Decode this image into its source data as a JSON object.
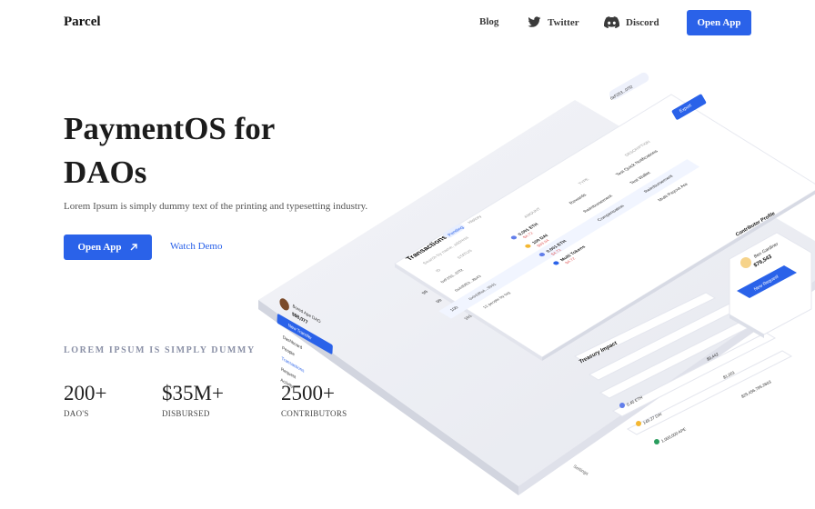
{
  "nav": {
    "logo": "Parcel",
    "blog": "Blog",
    "twitter": "Twitter",
    "discord": "Discord",
    "cta": "Open App"
  },
  "hero": {
    "title_line1": "PaymentOS for",
    "title_line2": "DAOs",
    "subtitle": "Lorem Ipsum is simply dummy text of the printing and typesetting industry.",
    "primary_button": "Open App",
    "secondary_link": "Watch Demo"
  },
  "stats": {
    "eyebrow": "LOREM IPSUM IS SIMPLY DUMMY",
    "items": [
      {
        "value": "200+",
        "label": "DAO'S"
      },
      {
        "value": "$35M+",
        "label": "DISBURSED"
      },
      {
        "value": "2500+",
        "label": "CONTRIBUTORS"
      }
    ]
  },
  "mockup": {
    "sidebar": {
      "dao_name": "Bored Ape DAO",
      "balance": "$98,077",
      "new_transfer": "New Transfer",
      "items": [
        "Dashboard",
        "People",
        "Transactions",
        "Request",
        "Activity"
      ],
      "settings": "Settings"
    },
    "header": {
      "address": "0xF253...07f2",
      "export": "Export",
      "title": "Transactions",
      "tab_pending": "Pending",
      "tab_history": "History",
      "search_placeholder": "Search by name, address"
    },
    "columns": [
      "ID",
      "STATUS",
      "AMOUNT",
      "TYPE",
      "DESCRIPTION"
    ],
    "rows": [
      {
        "id": "98",
        "date": "Dec 1, 2021",
        "who": "0xF253...07f2",
        "amount": "0.001 ETH",
        "fiat": "$4.72",
        "type": "Rewards",
        "desc": "Test Quick Notifications"
      },
      {
        "id": "99",
        "date": "Dec 1, 2021",
        "who": "0x4d5f63...8b43",
        "amount": "100 DAI",
        "fiat": "$99.94",
        "type": "Reimbursement",
        "desc": "Test Wallet"
      },
      {
        "id": "100",
        "date": "",
        "who": "0x9d3ffa4...99d1",
        "amount": "0.001 ETH",
        "fiat": "$4.72",
        "type": "Compensation",
        "desc": "Reimbursement"
      },
      {
        "id": "101",
        "date": "",
        "who": "12 people by tag",
        "amount": "Multi Tokens",
        "fiat": "$4.72",
        "type": "",
        "desc": "Multi Payout Are"
      }
    ],
    "treasury": {
      "title": "Treasury Impact",
      "lines": [
        "0.45 ETH",
        "149.27 DAI",
        "1,000,000 APE"
      ],
      "values": [
        "$9,442",
        "$1,001",
        "$25,456,795.2603"
      ]
    },
    "profile": {
      "title": "Contributor Profile",
      "name": "Ben Gardiner",
      "amount": "$76,543",
      "button": "New Request"
    }
  },
  "colors": {
    "accent": "#2a62e9",
    "eyebrow": "#8a90a6",
    "panel_shadow": "#d8dbe6"
  }
}
